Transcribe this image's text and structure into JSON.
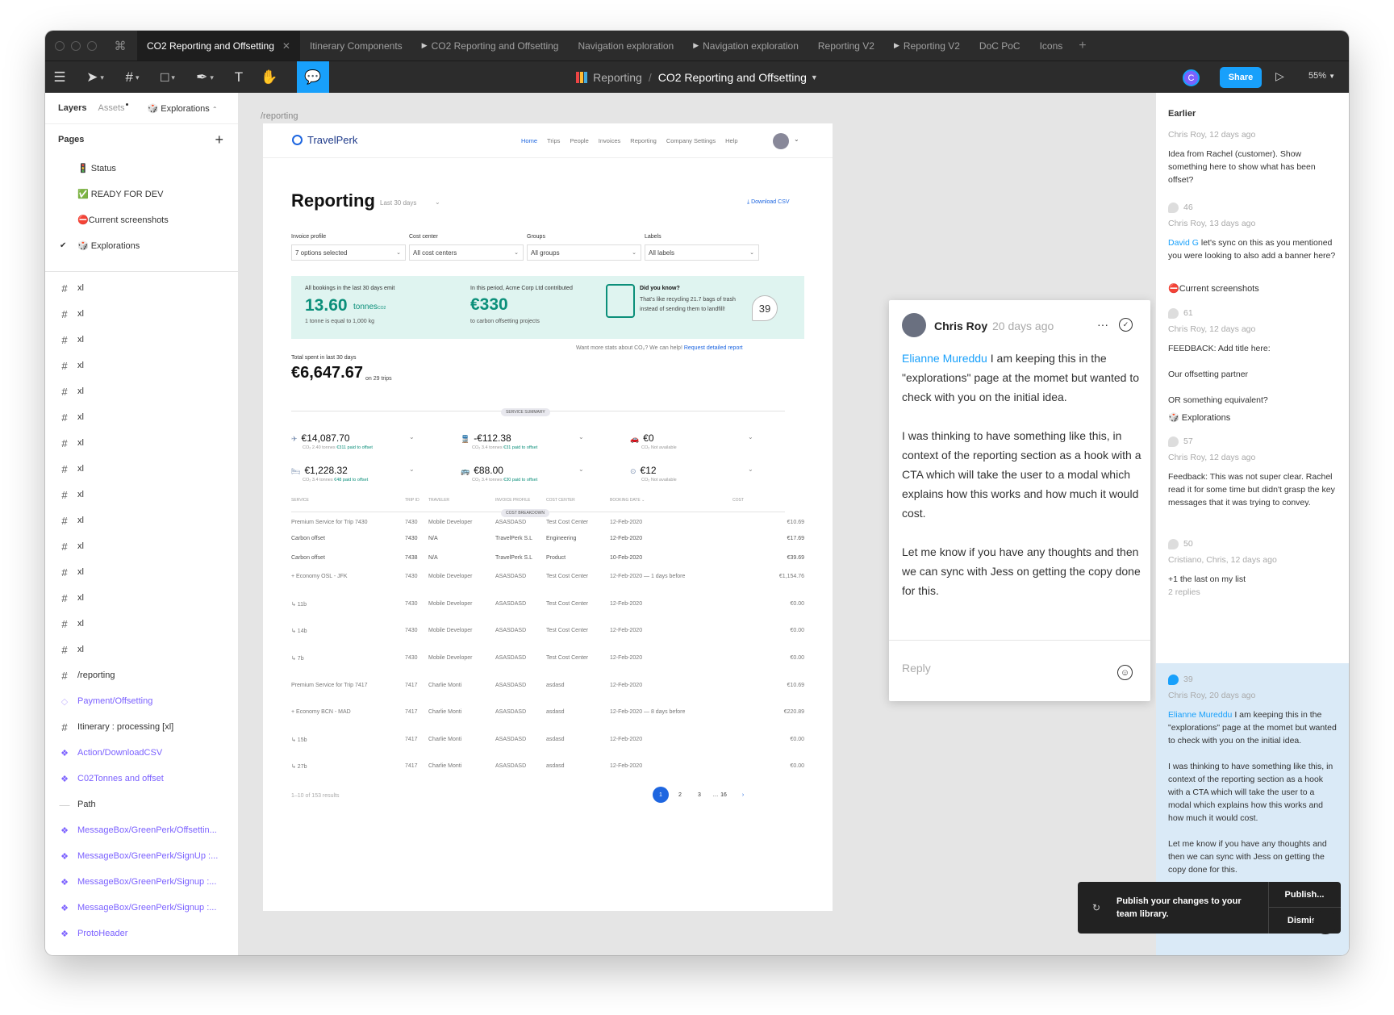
{
  "tabs": [
    {
      "label": "CO2 Reporting and Offsetting",
      "active": true,
      "proto": false
    },
    {
      "label": "Itinerary Components",
      "active": false,
      "proto": false
    },
    {
      "label": "CO2 Reporting and Offsetting",
      "active": false,
      "proto": true
    },
    {
      "label": "Navigation exploration",
      "active": false,
      "proto": false
    },
    {
      "label": "Navigation exploration",
      "active": false,
      "proto": true
    },
    {
      "label": "Reporting V2",
      "active": false,
      "proto": false
    },
    {
      "label": "Reporting V2",
      "active": false,
      "proto": true
    },
    {
      "label": "DoC PoC",
      "active": false,
      "proto": false
    },
    {
      "label": "Icons",
      "active": false,
      "proto": false
    }
  ],
  "toolbar": {
    "project": "Reporting",
    "file": "CO2 Reporting and Offsetting",
    "avatar_letter": "C",
    "share_label": "Share",
    "zoom": "55%"
  },
  "left": {
    "layers_label": "Layers",
    "assets_label": "Assets",
    "page_selector": "Explorations",
    "pages_label": "Pages",
    "pages": [
      {
        "label": "🚦 Status",
        "current": false
      },
      {
        "label": "✅ READY FOR DEV",
        "current": false
      },
      {
        "label": "⛔Current screenshots",
        "current": false
      },
      {
        "label": "🎲 Explorations",
        "current": true
      }
    ],
    "layers": [
      {
        "label": "xl",
        "type": "frame"
      },
      {
        "label": "xl",
        "type": "frame"
      },
      {
        "label": "xl",
        "type": "frame"
      },
      {
        "label": "xl",
        "type": "frame"
      },
      {
        "label": "xl",
        "type": "frame"
      },
      {
        "label": "xl",
        "type": "frame"
      },
      {
        "label": "xl",
        "type": "frame"
      },
      {
        "label": "xl",
        "type": "frame"
      },
      {
        "label": "xl",
        "type": "frame"
      },
      {
        "label": "xl",
        "type": "frame"
      },
      {
        "label": "xl",
        "type": "frame"
      },
      {
        "label": "xl",
        "type": "frame"
      },
      {
        "label": "xl",
        "type": "frame"
      },
      {
        "label": "xl",
        "type": "frame"
      },
      {
        "label": "xl",
        "type": "frame"
      },
      {
        "label": "/reporting",
        "type": "frame"
      },
      {
        "label": "Payment/Offsetting",
        "type": "instance-ghost"
      },
      {
        "label": "Itinerary : processing [xl]",
        "type": "frame"
      },
      {
        "label": "Action/DownloadCSV",
        "type": "component"
      },
      {
        "label": "C02Tonnes and offset",
        "type": "component"
      },
      {
        "label": "Path",
        "type": "path"
      },
      {
        "label": "MessageBox/GreenPerk/Offsettin...",
        "type": "component"
      },
      {
        "label": "MessageBox/GreenPerk/SignUp :...",
        "type": "component"
      },
      {
        "label": "MessageBox/GreenPerk/Signup :...",
        "type": "component"
      },
      {
        "label": "MessageBox/GreenPerk/Signup :...",
        "type": "component"
      },
      {
        "label": "ProtoHeader",
        "type": "component"
      }
    ]
  },
  "canvas": {
    "frame_label": "/reporting",
    "tp": {
      "logo": "TravelPerk",
      "nav": [
        "Home",
        "Trips",
        "People",
        "Invoices",
        "Reporting",
        "Company Settings",
        "Help"
      ],
      "title": "Reporting",
      "period": "Last 30 days",
      "download": "Download CSV",
      "filters": [
        {
          "label": "Invoice profile",
          "value": "7 options selected"
        },
        {
          "label": "Cost center",
          "value": "All cost centers"
        },
        {
          "label": "Groups",
          "value": "All groups"
        },
        {
          "label": "Labels",
          "value": "All labels"
        }
      ],
      "banner": {
        "emit_text": "All bookings in the last 30 days emit",
        "tonnes": "13.60",
        "tonnes_unit": "tonnes",
        "tonnes_unit_sub": "CO2",
        "tonne_eq": "1 tonne is equal to 1,000 kg",
        "contrib_text": "In this period, Acme Corp Ltd contributed",
        "contrib": "€330",
        "contrib_sub": "to carbon offsetting projects",
        "know_title": "Did you know?",
        "know_text": "That's like recycling 21.7 bags of trash instead of sending them to landfill!"
      },
      "comment_pin": "39",
      "more_stats": "Want more stats about CO₂? We can help!",
      "request_link": "Request detailed report",
      "total_label": "Total spent in last 30 days",
      "total": "€6,647.67",
      "trips": "on 29 trips",
      "service_summary": "SERVICE SUMMARY",
      "services": [
        {
          "icon": "✈",
          "amount": "€14,087.70",
          "sub": "2.40 tonnes",
          "paid": "€311 paid to offset"
        },
        {
          "icon": "🚆",
          "amount": "-€112.38",
          "sub": "3.4 tonnes",
          "paid": "€31 paid to offset"
        },
        {
          "icon": "🚗",
          "amount": "€0",
          "sub": "Not available",
          "paid": ""
        },
        {
          "icon": "🛏",
          "amount": "€1,228.32",
          "sub": "3.4 tonnes",
          "paid": "€48 paid to offset"
        },
        {
          "icon": "🚌",
          "amount": "€88.00",
          "sub": "3.4 tonnes",
          "paid": "€30 paid to offset"
        },
        {
          "icon": "⊙",
          "amount": "€12",
          "sub": "Not available",
          "paid": ""
        }
      ],
      "cost_breakdown": "COST BREAKDOWN",
      "columns": [
        "SERVICE",
        "TRIP ID",
        "TRAVELER",
        "INVOICE PROFILE",
        "COST CENTER",
        "BOOKING DATE",
        "COST"
      ],
      "rows": [
        [
          "Premium Service for Trip 7430",
          "7430",
          "Mobile Developer",
          "ASASDASD",
          "Test Cost Center",
          "12-Feb-2020",
          "€10.69"
        ],
        [
          "Carbon offset",
          "7430",
          "N/A",
          "TravelPerk S.L",
          "Engineering",
          "12-Feb-2020",
          "€17.69"
        ],
        [
          "Carbon offset",
          "7438",
          "N/A",
          "TravelPerk S.L",
          "Product",
          "10-Feb-2020",
          "€39.69"
        ],
        [
          "+ Economy OSL - JFK",
          "7430",
          "Mobile Developer",
          "ASASDASD",
          "Test Cost Center",
          "12-Feb-2020 — 1 days before",
          "€1,154.76"
        ],
        [
          "↳ 11b",
          "7430",
          "Mobile Developer",
          "ASASDASD",
          "Test Cost Center",
          "12-Feb-2020",
          "€0.00"
        ],
        [
          "↳ 14b",
          "7430",
          "Mobile Developer",
          "ASASDASD",
          "Test Cost Center",
          "12-Feb-2020",
          "€0.00"
        ],
        [
          "↳ 7b",
          "7430",
          "Mobile Developer",
          "ASASDASD",
          "Test Cost Center",
          "12-Feb-2020",
          "€0.00"
        ],
        [
          "Premium Service for Trip 7417",
          "7417",
          "Charlie Monti",
          "ASASDASD",
          "asdasd",
          "12-Feb-2020",
          "€10.69"
        ],
        [
          "+ Economy BCN - MAD",
          "7417",
          "Charlie Monti",
          "ASASDASD",
          "asdasd",
          "12-Feb-2020 — 8 days before",
          "€220.89"
        ],
        [
          "↳ 15b",
          "7417",
          "Charlie Monti",
          "ASASDASD",
          "asdasd",
          "12-Feb-2020",
          "€0.00"
        ],
        [
          "↳ 27b",
          "7417",
          "Charlie Monti",
          "ASASDASD",
          "asdasd",
          "12-Feb-2020",
          "€0.00"
        ]
      ],
      "results": "1–10 of 153 results",
      "pages": [
        "1",
        "2",
        "3",
        "…",
        "16",
        "›"
      ]
    }
  },
  "comment": {
    "author": "Chris Roy",
    "time": "20 days ago",
    "mention": "Elianne Mureddu",
    "p1": "I am keeping this in the \"explorations\" page at the momet but wanted to check with you on the initial idea.",
    "p2": "I was thinking to have something like this, in context of the reporting section as a hook with a CTA which will take the user to a modal which explains how this works and how much it would cost.",
    "p3": "Let me know if you have any thoughts and then we can sync with Jess on getting the copy done for this.",
    "reply_placeholder": "Reply"
  },
  "right": {
    "earlier": "Earlier",
    "c1_meta": "Chris Roy, 12 days ago",
    "c1_text": "Idea from Rachel (customer). Show something here to show what has been offset?",
    "c2_num": "46",
    "c2_meta": "Chris Roy, 13 days ago",
    "c2_mention": "David G",
    "c2_text": "let's sync on this as you mentioned you were looking to also add a banner here?",
    "sec1": "⛔Current screenshots",
    "c3_num": "61",
    "c3_meta": "Chris Roy, 12 days ago",
    "c3_t1": "FEEDBACK: Add title here:",
    "c3_t2": "Our offsetting partner",
    "c3_t3": "OR something equivalent?",
    "sec2": "🎲 Explorations",
    "c4_num": "57",
    "c4_meta": "Chris Roy, 12 days ago",
    "c4_text": "Feedback: This was not super clear. Rachel read it for some time but didn't grasp the key messages that it was trying to convey.",
    "c5_num": "50",
    "c5_meta": "Cristiano, Chris, 12 days ago",
    "c5_text": "+1 the last on my list",
    "c5_replies": "2 replies",
    "c6_num": "39",
    "c6_meta": "Chris Roy, 20 days ago"
  },
  "toast": {
    "message": "Publish your changes to your team library.",
    "publish": "Publish...",
    "dismiss": "Dismiss"
  }
}
